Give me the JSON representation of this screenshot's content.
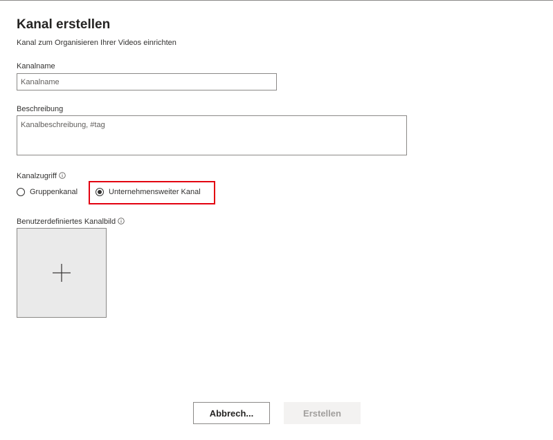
{
  "dialog": {
    "title": "Kanal erstellen",
    "subtitle": "Kanal zum Organisieren Ihrer Videos einrichten"
  },
  "fields": {
    "name": {
      "label": "Kanalname",
      "placeholder": "Kanalname",
      "value": ""
    },
    "description": {
      "label": "Beschreibung",
      "placeholder": "Kanalbeschreibung, #tag",
      "value": ""
    },
    "access": {
      "label": "Kanalzugriff",
      "options": [
        {
          "label": "Gruppenkanal",
          "selected": false
        },
        {
          "label": "Unternehmensweiter Kanal",
          "selected": true
        }
      ],
      "highlight_color": "#e3000f"
    },
    "image": {
      "label": "Benutzerdefiniertes Kanalbild",
      "add_icon": "plus-icon"
    }
  },
  "buttons": {
    "cancel": "Abbrech...",
    "create": "Erstellen"
  },
  "colors": {
    "text": "#252423",
    "border": "#8a8886",
    "tile_background": "#eaeaea",
    "disabled_text": "#a19f9d",
    "disabled_background": "#f3f2f1"
  }
}
